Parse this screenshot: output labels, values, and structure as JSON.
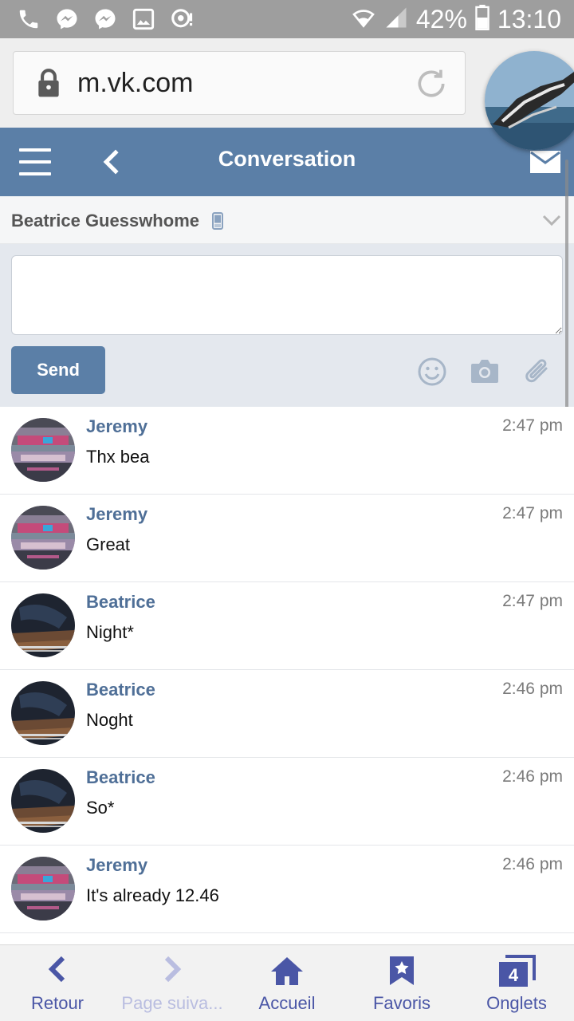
{
  "status_bar": {
    "battery_percent": "42%",
    "time": "13:10",
    "icons_left": [
      "phone-icon",
      "messenger-icon",
      "messenger-icon",
      "image-icon",
      "voice-icon"
    ],
    "icons_right": [
      "wifi-icon",
      "signal-icon",
      "battery-icon"
    ]
  },
  "browser": {
    "url": "m.vk.com"
  },
  "header": {
    "title": "Conversation"
  },
  "peer": {
    "name": "Beatrice Guesswhome"
  },
  "compose": {
    "placeholder": "",
    "send_label": "Send"
  },
  "messages": [
    {
      "author": "Jeremy",
      "time": "2:47 pm",
      "text": "Thx bea",
      "avatar": "jeremy"
    },
    {
      "author": "Jeremy",
      "time": "2:47 pm",
      "text": "Great",
      "avatar": "jeremy"
    },
    {
      "author": "Beatrice",
      "time": "2:47 pm",
      "text": "Night*",
      "avatar": "beatrice"
    },
    {
      "author": "Beatrice",
      "time": "2:46 pm",
      "text": "Noght",
      "avatar": "beatrice"
    },
    {
      "author": "Beatrice",
      "time": "2:46 pm",
      "text": "So*",
      "avatar": "beatrice"
    },
    {
      "author": "Jeremy",
      "time": "2:46 pm",
      "text": "It's already 12.46",
      "avatar": "jeremy"
    }
  ],
  "bottom_nav": {
    "back": "Retour",
    "forward": "Page suiva...",
    "home": "Accueil",
    "favorites": "Favoris",
    "tabs": "Onglets",
    "tab_count": "4"
  },
  "colors": {
    "vk_blue": "#5b7fa7",
    "author_blue": "#4f6f97",
    "nav_purple": "#4a56a6"
  }
}
